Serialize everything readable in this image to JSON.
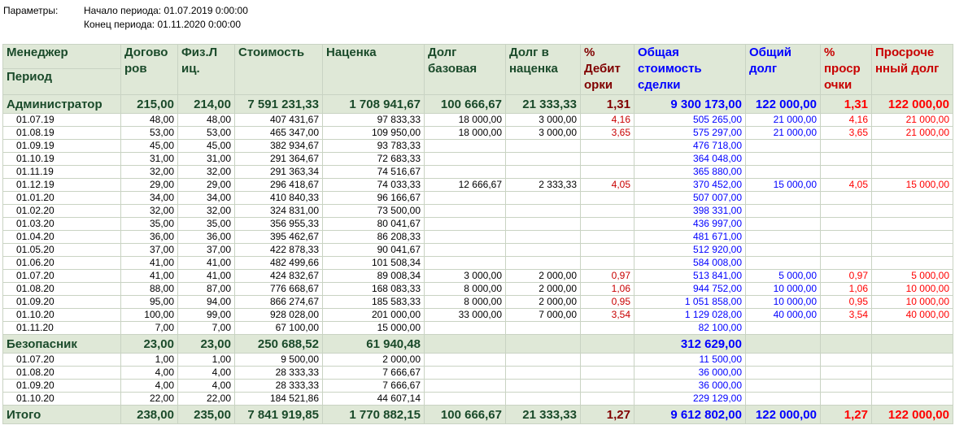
{
  "params": {
    "label": "Параметры:",
    "period_start": "Начало периода: 01.07.2019 0:00:00",
    "period_end": "Конец периода: 01.11.2020 0:00:00"
  },
  "headers": {
    "manager": "Менеджер",
    "period": "Период",
    "contracts": "Догово ров",
    "persons": "Физ.Л иц.",
    "cost": "Стоимость",
    "markup": "Наценка",
    "debt_base": "Долг базовая",
    "debt_markup": "Долг в наценка",
    "pct_debt": "% Дебит орки",
    "total_cost": "Общая стоимость сделки",
    "total_debt": "Общий долг",
    "pct_overdue": "% проср очки",
    "overdue_debt": "Просроче нный долг"
  },
  "groups": [
    {
      "name": "Администратор",
      "totals": [
        "215,00",
        "214,00",
        "7 591 231,33",
        "1 708 941,67",
        "100 666,67",
        "21 333,33",
        "1,31",
        "9 300 173,00",
        "122 000,00",
        "1,31",
        "122 000,00"
      ],
      "rows": [
        [
          "01.07.19",
          "48,00",
          "48,00",
          "407 431,67",
          "97 833,33",
          "18 000,00",
          "3 000,00",
          "4,16",
          "505 265,00",
          "21 000,00",
          "4,16",
          "21 000,00"
        ],
        [
          "01.08.19",
          "53,00",
          "53,00",
          "465 347,00",
          "109 950,00",
          "18 000,00",
          "3 000,00",
          "3,65",
          "575 297,00",
          "21 000,00",
          "3,65",
          "21 000,00"
        ],
        [
          "01.09.19",
          "45,00",
          "45,00",
          "382 934,67",
          "93 783,33",
          "",
          "",
          "",
          "476 718,00",
          "",
          "",
          ""
        ],
        [
          "01.10.19",
          "31,00",
          "31,00",
          "291 364,67",
          "72 683,33",
          "",
          "",
          "",
          "364 048,00",
          "",
          "",
          ""
        ],
        [
          "01.11.19",
          "32,00",
          "32,00",
          "291 363,34",
          "74 516,67",
          "",
          "",
          "",
          "365 880,00",
          "",
          "",
          ""
        ],
        [
          "01.12.19",
          "29,00",
          "29,00",
          "296 418,67",
          "74 033,33",
          "12 666,67",
          "2 333,33",
          "4,05",
          "370 452,00",
          "15 000,00",
          "4,05",
          "15 000,00"
        ],
        [
          "01.01.20",
          "34,00",
          "34,00",
          "410 840,33",
          "96 166,67",
          "",
          "",
          "",
          "507 007,00",
          "",
          "",
          ""
        ],
        [
          "01.02.20",
          "32,00",
          "32,00",
          "324 831,00",
          "73 500,00",
          "",
          "",
          "",
          "398 331,00",
          "",
          "",
          ""
        ],
        [
          "01.03.20",
          "35,00",
          "35,00",
          "356 955,33",
          "80 041,67",
          "",
          "",
          "",
          "436 997,00",
          "",
          "",
          ""
        ],
        [
          "01.04.20",
          "36,00",
          "36,00",
          "395 462,67",
          "86 208,33",
          "",
          "",
          "",
          "481 671,00",
          "",
          "",
          ""
        ],
        [
          "01.05.20",
          "37,00",
          "37,00",
          "422 878,33",
          "90 041,67",
          "",
          "",
          "",
          "512 920,00",
          "",
          "",
          ""
        ],
        [
          "01.06.20",
          "41,00",
          "41,00",
          "482 499,66",
          "101 508,34",
          "",
          "",
          "",
          "584 008,00",
          "",
          "",
          ""
        ],
        [
          "01.07.20",
          "41,00",
          "41,00",
          "424 832,67",
          "89 008,34",
          "3 000,00",
          "2 000,00",
          "0,97",
          "513 841,00",
          "5 000,00",
          "0,97",
          "5 000,00"
        ],
        [
          "01.08.20",
          "88,00",
          "87,00",
          "776 668,67",
          "168 083,33",
          "8 000,00",
          "2 000,00",
          "1,06",
          "944 752,00",
          "10 000,00",
          "1,06",
          "10 000,00"
        ],
        [
          "01.09.20",
          "95,00",
          "94,00",
          "866 274,67",
          "185 583,33",
          "8 000,00",
          "2 000,00",
          "0,95",
          "1 051 858,00",
          "10 000,00",
          "0,95",
          "10 000,00"
        ],
        [
          "01.10.20",
          "100,00",
          "99,00",
          "928 028,00",
          "201 000,00",
          "33 000,00",
          "7 000,00",
          "3,54",
          "1 129 028,00",
          "40 000,00",
          "3,54",
          "40 000,00"
        ],
        [
          "01.11.20",
          "7,00",
          "7,00",
          "67 100,00",
          "15 000,00",
          "",
          "",
          "",
          "82 100,00",
          "",
          "",
          ""
        ]
      ]
    },
    {
      "name": "Безопасник",
      "totals": [
        "23,00",
        "23,00",
        "250 688,52",
        "61 940,48",
        "",
        "",
        "",
        "312 629,00",
        "",
        "",
        ""
      ],
      "rows": [
        [
          "01.07.20",
          "1,00",
          "1,00",
          "9 500,00",
          "2 000,00",
          "",
          "",
          "",
          "11 500,00",
          "",
          "",
          ""
        ],
        [
          "01.08.20",
          "4,00",
          "4,00",
          "28 333,33",
          "7 666,67",
          "",
          "",
          "",
          "36 000,00",
          "",
          "",
          ""
        ],
        [
          "01.09.20",
          "4,00",
          "4,00",
          "28 333,33",
          "7 666,67",
          "",
          "",
          "",
          "36 000,00",
          "",
          "",
          ""
        ],
        [
          "01.10.20",
          "22,00",
          "22,00",
          "184 521,86",
          "44 607,14",
          "",
          "",
          "",
          "229 129,00",
          "",
          "",
          ""
        ]
      ]
    }
  ],
  "total": {
    "name": "Итого",
    "values": [
      "238,00",
      "235,00",
      "7 841 919,85",
      "1 770 882,15",
      "100 666,67",
      "21 333,33",
      "1,27",
      "9 612 802,00",
      "122 000,00",
      "1,27",
      "122 000,00"
    ]
  },
  "colors": {
    "header_bg": "#dfe8d7",
    "header_text": "#1a4a2a",
    "blue": "#0000ff",
    "red": "#ff0000",
    "maroon": "#800000"
  }
}
